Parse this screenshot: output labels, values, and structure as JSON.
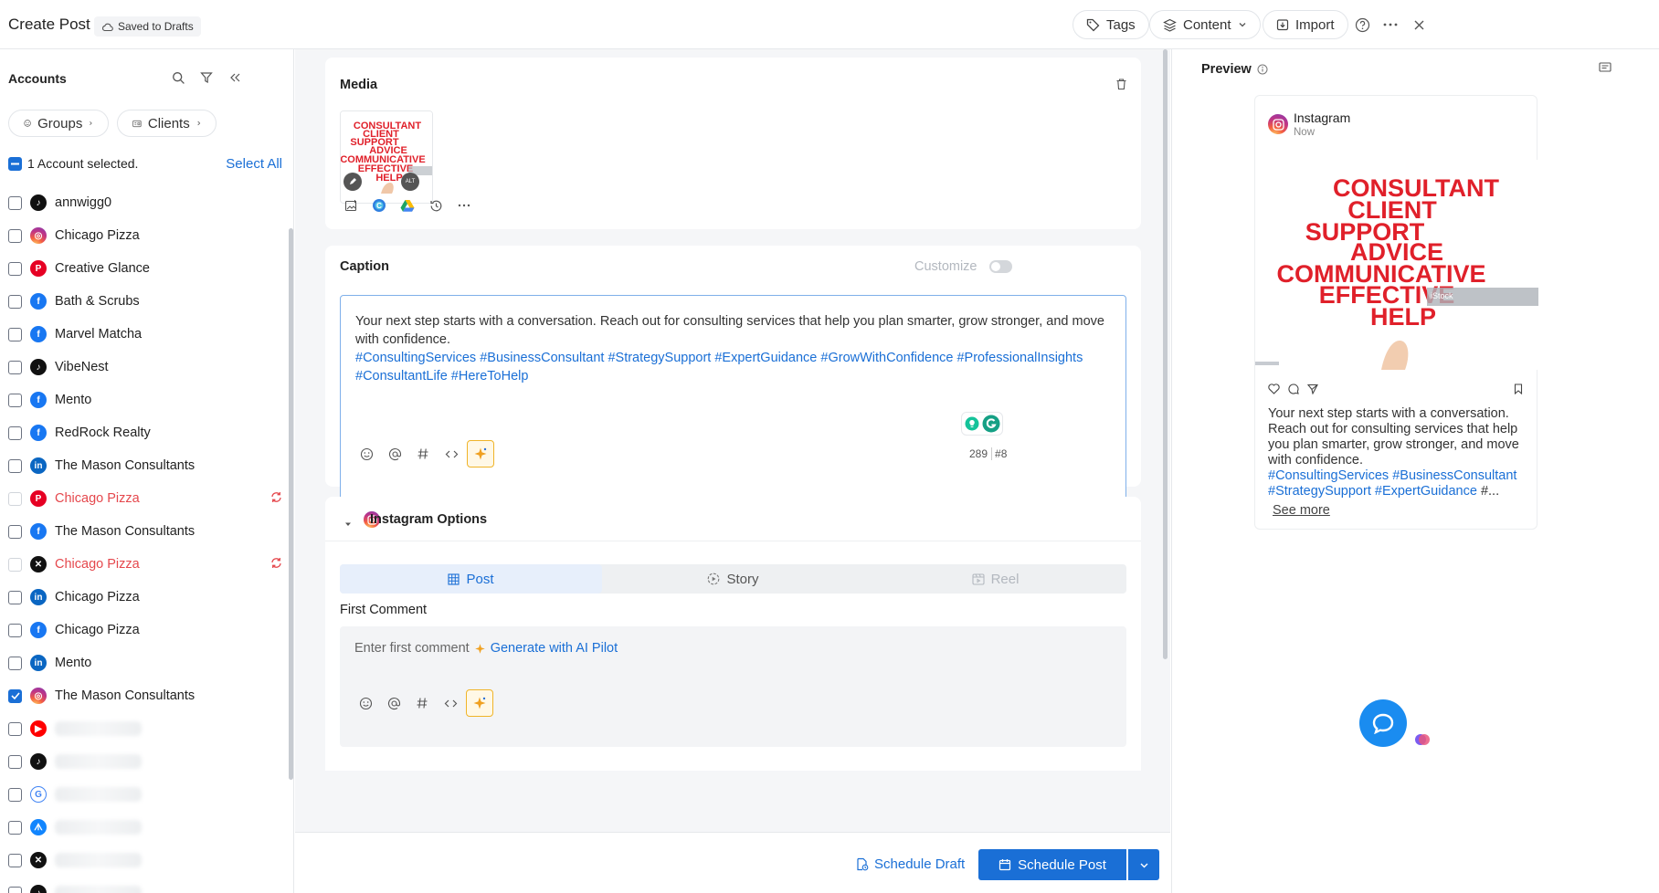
{
  "header": {
    "title": "Create Post",
    "saved_badge": "Saved to Drafts",
    "tags_label": "Tags",
    "content_label": "Content",
    "import_label": "Import"
  },
  "accounts": {
    "title": "Accounts",
    "groups_label": "Groups",
    "clients_label": "Clients",
    "selected_text": "1 Account selected.",
    "select_all": "Select All",
    "items": [
      {
        "name": "annwigg0",
        "network": "tiktok",
        "checked": false
      },
      {
        "name": "Chicago Pizza",
        "network": "instagram",
        "checked": false
      },
      {
        "name": "Creative Glance",
        "network": "pinterest",
        "checked": false
      },
      {
        "name": "Bath & Scrubs",
        "network": "facebook",
        "checked": false
      },
      {
        "name": "Marvel Matcha",
        "network": "facebook",
        "checked": false
      },
      {
        "name": "VibeNest",
        "network": "tiktok",
        "checked": false
      },
      {
        "name": "Mento",
        "network": "facebook",
        "checked": false
      },
      {
        "name": "RedRock Realty",
        "network": "facebook",
        "checked": false
      },
      {
        "name": "The Mason Consultants",
        "network": "linkedin",
        "checked": false
      },
      {
        "name": "Chicago Pizza",
        "network": "pinterest",
        "checked": false,
        "error": true
      },
      {
        "name": "The Mason Consultants",
        "network": "facebook",
        "checked": false
      },
      {
        "name": "Chicago Pizza",
        "network": "x",
        "checked": false,
        "error": true
      },
      {
        "name": "Chicago Pizza",
        "network": "linkedin",
        "checked": false
      },
      {
        "name": "Chicago Pizza",
        "network": "facebook",
        "checked": false
      },
      {
        "name": "Mento",
        "network": "linkedin",
        "checked": false
      },
      {
        "name": "The Mason Consultants",
        "network": "instagram",
        "checked": true
      },
      {
        "name": "",
        "network": "youtube",
        "checked": false
      },
      {
        "name": "",
        "network": "tiktok",
        "checked": false
      },
      {
        "name": "",
        "network": "google",
        "checked": false
      },
      {
        "name": "",
        "network": "bluesky",
        "checked": false
      },
      {
        "name": "",
        "network": "x",
        "checked": false
      },
      {
        "name": "",
        "network": "tiktok",
        "checked": false
      }
    ]
  },
  "media": {
    "title": "Media",
    "image_words": [
      "CONSULTANT",
      "CLIENT",
      "SUPPORT",
      "ADVICE",
      "COMMUNICATIVE",
      "EFFECTIVE",
      "HELP"
    ],
    "alt_badge": "ALT"
  },
  "caption": {
    "title": "Caption",
    "customize_label": "Customize",
    "text": "Your next step starts with a conversation. Reach out for consulting services that help you plan smarter, grow stronger, and move with confidence.",
    "hashtags": "#ConsultingServices #BusinessConsultant #StrategySupport #ExpertGuidance #GrowWithConfidence #ProfessionalInsights #ConsultantLife #HereToHelp",
    "char_count": "289",
    "hashtag_count": "#8"
  },
  "instagram_options": {
    "title": "Instagram Options",
    "tabs": [
      "Post",
      "Story",
      "Reel"
    ],
    "first_comment_label": "First Comment",
    "first_comment_placeholder": "Enter first comment",
    "generate_label": "Generate with AI Pilot"
  },
  "footer": {
    "schedule_draft": "Schedule Draft",
    "schedule_post": "Schedule Post"
  },
  "preview": {
    "title": "Preview",
    "network": "Instagram",
    "time": "Now",
    "watermark": "iStock",
    "text": "Your next step starts with a conversation. Reach out for consulting services that help you plan smarter, grow stronger, and move with confidence.",
    "hashtags_line1": "#ConsultingServices #BusinessConsultant",
    "hashtags_line2": "#StrategySupport #ExpertGuidance",
    "ellipsis": " #...",
    "see_more": "See more"
  },
  "colors": {
    "accent": "#1a6fd6",
    "error": "#e5484d",
    "image_red": "#e0202a",
    "image_blue": "#1f4f9a"
  }
}
